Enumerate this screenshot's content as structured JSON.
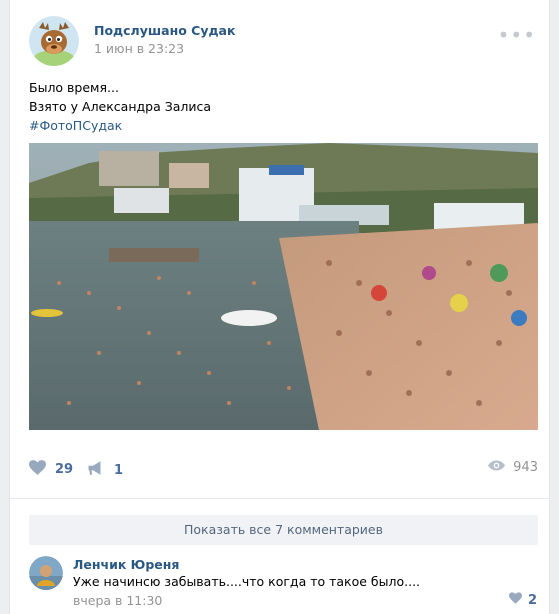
{
  "post": {
    "author": "Подслушано Судак",
    "date": "1 июн в 23:23",
    "more": "•••",
    "text_line1": "Было время...",
    "text_line2": "Взято у Александра Залиса",
    "hashtag": "#ФотоПСудак"
  },
  "actions": {
    "likes": "29",
    "shares": "1",
    "views": "943"
  },
  "comments": {
    "show_all_label": "Показать все 7 комментариев",
    "items": [
      {
        "author": "Ленчик Юреня",
        "text": "Уже начинсю забывать....что когда то такое было....",
        "date": "вчера в 11:30",
        "likes": "2"
      }
    ]
  },
  "colors": {
    "link": "#2a5885",
    "action": "#4a6da0",
    "muted": "#939393",
    "page_bg": "#edeef0"
  }
}
